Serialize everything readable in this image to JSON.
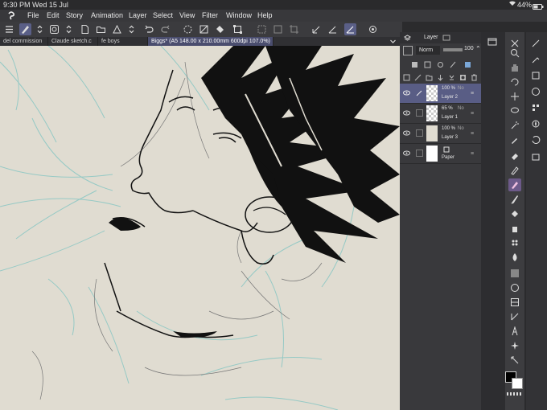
{
  "status": {
    "time": "9:30 PM",
    "date": "Wed 15 Jul",
    "battery": "44%",
    "wifi_icon": "wifi-icon",
    "battery_icon": "battery-icon"
  },
  "menu": {
    "logo_icon": "clip-studio-logo-icon",
    "items": [
      "File",
      "Edit",
      "Story",
      "Animation",
      "Layer",
      "Select",
      "View",
      "Filter",
      "Window",
      "Help"
    ]
  },
  "tabs": [
    {
      "label": "del commission",
      "active": false
    },
    {
      "label": "Claude sketch.c",
      "active": false
    },
    {
      "label": "fe boys",
      "active": false
    },
    {
      "label": "Biggs* (A5 148.00 x 210.00mm 600dpi 107.0%)",
      "active": true
    }
  ],
  "layer_panel": {
    "tab_label": "Layer",
    "blend_mode": "Norm",
    "opacity_value": "100",
    "layers": [
      {
        "opacity": "100 %",
        "mode": "No",
        "name": "Layer 2",
        "selected": true
      },
      {
        "opacity": "65 %",
        "mode": "No",
        "name": "Layer 1",
        "selected": false
      },
      {
        "opacity": "100 %",
        "mode": "No",
        "name": "Layer 3",
        "selected": false
      },
      {
        "opacity": "",
        "mode": "",
        "name": "Paper",
        "selected": false
      }
    ]
  },
  "colors": {
    "accent": "#5a5f87",
    "canvas_bg": "#e0dcd1",
    "sketch_blue": "#8ec8c4",
    "ink": "#111111",
    "main_color": "#000000",
    "sub_color": "#ffffff"
  }
}
